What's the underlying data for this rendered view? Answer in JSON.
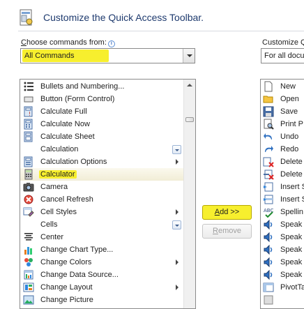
{
  "header": {
    "title": "Customize the Quick Access Toolbar."
  },
  "choose": {
    "label_prefix": "",
    "label_underlined": "C",
    "label_rest": "hoose commands from:",
    "selected": "All Commands"
  },
  "customize": {
    "label": "Customize Q",
    "selected": "For all docu"
  },
  "commands": [
    {
      "label": "Bullets and Numbering...",
      "icon": "bullets-icon",
      "extra": "none"
    },
    {
      "label": "Button (Form Control)",
      "icon": "form-button-icon",
      "extra": "none"
    },
    {
      "label": "Calculate Full",
      "icon": "calculate-full-icon",
      "extra": "none"
    },
    {
      "label": "Calculate Now",
      "icon": "calculate-now-icon",
      "extra": "none"
    },
    {
      "label": "Calculate Sheet",
      "icon": "calculate-sheet-icon",
      "extra": "none"
    },
    {
      "label": "Calculation",
      "icon": "none",
      "extra": "split"
    },
    {
      "label": "Calculation Options",
      "icon": "calculation-options-icon",
      "extra": "arrow"
    },
    {
      "label": "Calculator",
      "icon": "calculator-icon",
      "extra": "none",
      "selected": true
    },
    {
      "label": "Camera",
      "icon": "camera-icon",
      "extra": "none"
    },
    {
      "label": "Cancel Refresh",
      "icon": "cancel-refresh-icon",
      "extra": "none"
    },
    {
      "label": "Cell Styles",
      "icon": "cell-styles-icon",
      "extra": "arrow"
    },
    {
      "label": "Cells",
      "icon": "none",
      "extra": "split"
    },
    {
      "label": "Center",
      "icon": "center-align-icon",
      "extra": "none"
    },
    {
      "label": "Change Chart Type...",
      "icon": "chart-type-icon",
      "extra": "none"
    },
    {
      "label": "Change Colors",
      "icon": "colors-icon",
      "extra": "arrow"
    },
    {
      "label": "Change Data Source...",
      "icon": "data-source-icon",
      "extra": "none"
    },
    {
      "label": "Change Layout",
      "icon": "layout-icon",
      "extra": "arrow"
    },
    {
      "label": "Change Picture",
      "icon": "picture-icon",
      "extra": "none"
    }
  ],
  "buttons": {
    "add_underlined": "A",
    "add_rest": "dd >>",
    "remove_underlined": "R",
    "remove_rest": "emove"
  },
  "qat": [
    {
      "label": "New",
      "icon": "new-document-icon"
    },
    {
      "label": "Open",
      "icon": "open-folder-icon"
    },
    {
      "label": "Save",
      "icon": "save-icon"
    },
    {
      "label": "Print P",
      "icon": "print-preview-icon"
    },
    {
      "label": "Undo",
      "icon": "undo-icon"
    },
    {
      "label": "Redo",
      "icon": "redo-icon"
    },
    {
      "label": "Delete",
      "icon": "delete-cells-icon"
    },
    {
      "label": "Delete",
      "icon": "delete-icon"
    },
    {
      "label": "Insert S",
      "icon": "insert-sheet-icon"
    },
    {
      "label": "Insert S",
      "icon": "insert-sheet-rows-icon"
    },
    {
      "label": "Spellin",
      "icon": "spelling-icon"
    },
    {
      "label": "Speak",
      "icon": "speak-icon"
    },
    {
      "label": "Speak",
      "icon": "speak-icon"
    },
    {
      "label": "Speak",
      "icon": "speak-icon"
    },
    {
      "label": "Speak",
      "icon": "speak-icon"
    },
    {
      "label": "Speak",
      "icon": "speak-icon"
    },
    {
      "label": "PivotTa",
      "icon": "pivot-table-icon"
    },
    {
      "label": "",
      "icon": "generic-icon"
    }
  ],
  "colors": {
    "highlight": "#f7ef2e",
    "title": "#1e3a6e"
  }
}
